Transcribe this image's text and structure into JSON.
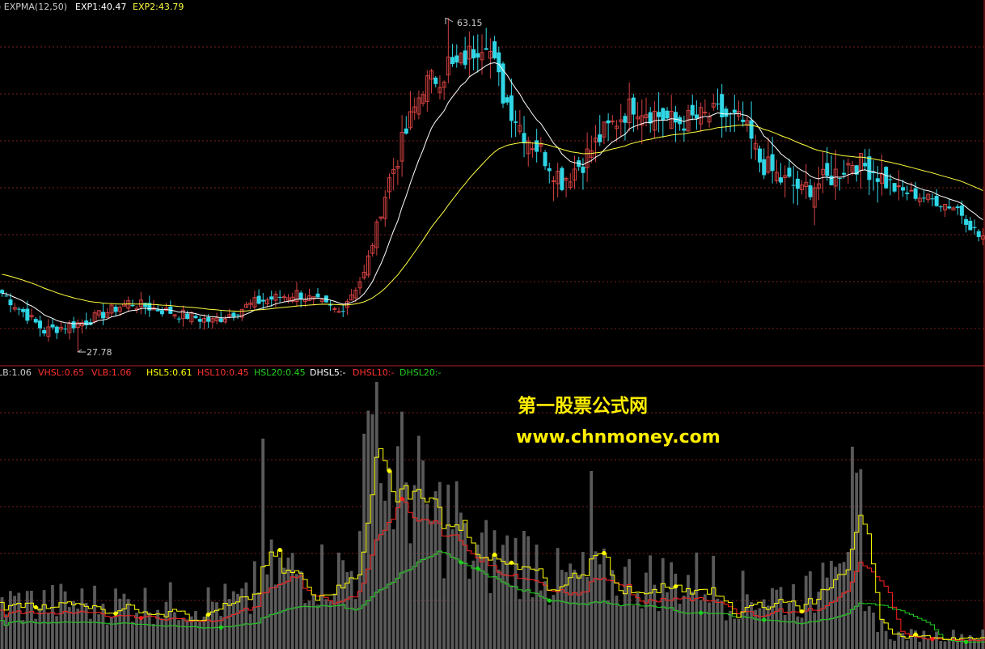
{
  "upper_indicator": {
    "name": "EXPMA(12,50)",
    "exp1": "EXP1:40.47",
    "exp2": "EXP2:43.79"
  },
  "price_annotations": {
    "high": "63.15",
    "low": "27.78"
  },
  "lower_indicator": {
    "lb": "LB:1.06",
    "vhsl": "VHSL:0.65",
    "vlb": "VLB:1.06",
    "hsl5": "HSL5:0.61",
    "hsl10": "HSL10:0.45",
    "hsl20": "HSL20:0.45",
    "dhsl5": "DHSL5:-",
    "dhsl10": "DHSL10:-",
    "dhsl20": "DHSL20:-"
  },
  "watermark": {
    "line1": "第一股票公式网",
    "line2": "www.chnmoney.com"
  },
  "colors": {
    "background": "#000000",
    "up_candle": "#d04040",
    "down_candle": "#2fd6e6",
    "exp1_line": "#ffffff",
    "exp2_line": "#ffff40",
    "grid": "#7a1f1f",
    "separator": "#b02020",
    "volume_bar": "#5a5a5a",
    "hsl_yellow": "#ffff00",
    "hsl_red": "#ff2020",
    "hsl_green": "#20d020",
    "watermark": "#ffee00"
  },
  "chart_data": [
    {
      "type": "candlestick",
      "title": "EXPMA(12,50)",
      "annotations": [
        {
          "label": "63.15",
          "kind": "high"
        },
        {
          "label": "27.78",
          "kind": "low"
        }
      ],
      "series": [
        {
          "name": "EXP1",
          "last": 40.47
        },
        {
          "name": "EXP2",
          "last": 43.79
        }
      ],
      "keypoints_close": [
        [
          0,
          34
        ],
        [
          10,
          30
        ],
        [
          20,
          31
        ],
        [
          30,
          33
        ],
        [
          40,
          32
        ],
        [
          50,
          31
        ],
        [
          60,
          33
        ],
        [
          70,
          34
        ],
        [
          80,
          32
        ],
        [
          86,
          36
        ],
        [
          92,
          46
        ],
        [
          100,
          56
        ],
        [
          108,
          58
        ],
        [
          115,
          61
        ],
        [
          119,
          55
        ],
        [
          124,
          51
        ],
        [
          128,
          49
        ],
        [
          133,
          46
        ],
        [
          138,
          48
        ],
        [
          143,
          51
        ],
        [
          150,
          54
        ],
        [
          160,
          52
        ],
        [
          170,
          53
        ],
        [
          176,
          52
        ],
        [
          180,
          48
        ],
        [
          185,
          46
        ],
        [
          190,
          45
        ],
        [
          196,
          46
        ],
        [
          202,
          48
        ],
        [
          207,
          47
        ],
        [
          212,
          45
        ],
        [
          220,
          44
        ],
        [
          227,
          43
        ],
        [
          232,
          40
        ]
      ]
    },
    {
      "type": "bar",
      "title": "",
      "series": [
        {
          "name": "HSL5",
          "last": 0.61
        },
        {
          "name": "HSL10",
          "last": 0.45
        },
        {
          "name": "HSL20",
          "last": 0.45
        }
      ]
    }
  ]
}
